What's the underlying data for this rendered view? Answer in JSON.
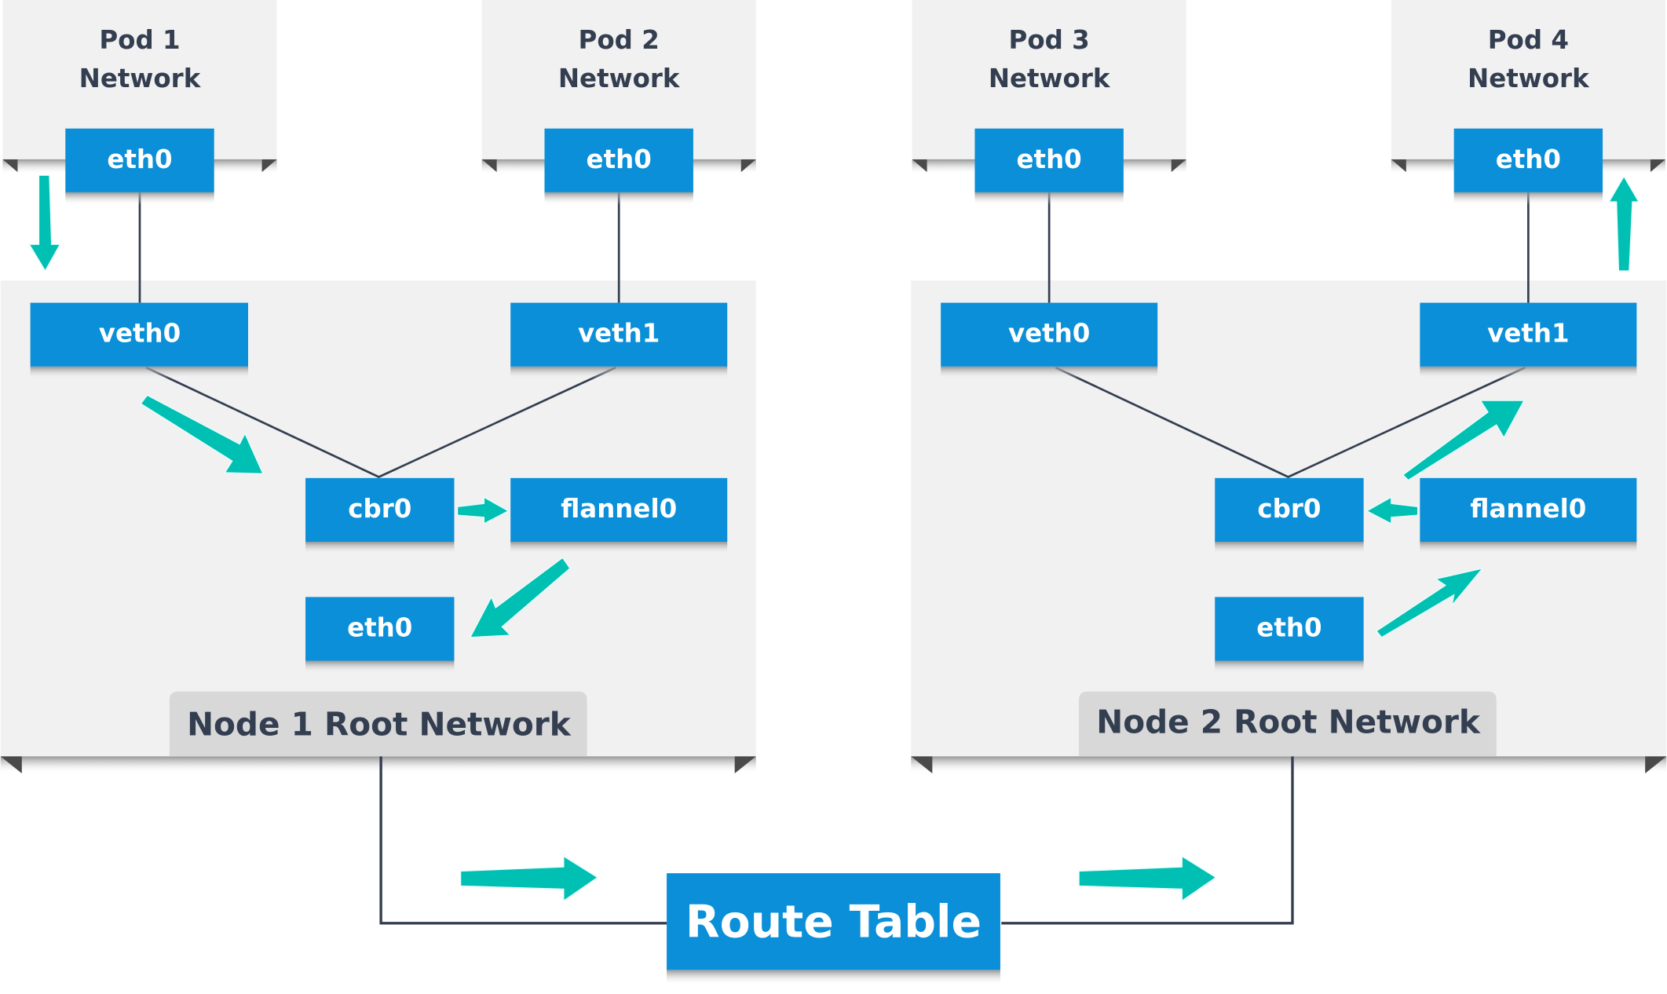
{
  "colors": {
    "interface_box": "#0a8fd8",
    "interface_text": "#ffffff",
    "panel": "#f1f1f1",
    "panel_label_tab": "#d8d8d8",
    "heading_text": "#333e50",
    "wire": "#333e50",
    "flow_arrow": "#00bfb3",
    "corner": "#4a4a4a"
  },
  "pods": [
    {
      "title_line1": "Pod 1",
      "title_line2": "Network",
      "iface": "eth0"
    },
    {
      "title_line1": "Pod 2",
      "title_line2": "Network",
      "iface": "eth0"
    },
    {
      "title_line1": "Pod 3",
      "title_line2": "Network",
      "iface": "eth0"
    },
    {
      "title_line1": "Pod 4",
      "title_line2": "Network",
      "iface": "eth0"
    }
  ],
  "nodes": [
    {
      "label": "Node 1 Root Network",
      "veth_left": "veth0",
      "veth_right": "veth1",
      "bridge": "cbr0",
      "overlay": "flannel0",
      "eth": "eth0"
    },
    {
      "label": "Node 2 Root Network",
      "veth_left": "veth0",
      "veth_right": "veth1",
      "bridge": "cbr0",
      "overlay": "flannel0",
      "eth": "eth0"
    }
  ],
  "route_table": {
    "label": "Route Table"
  }
}
